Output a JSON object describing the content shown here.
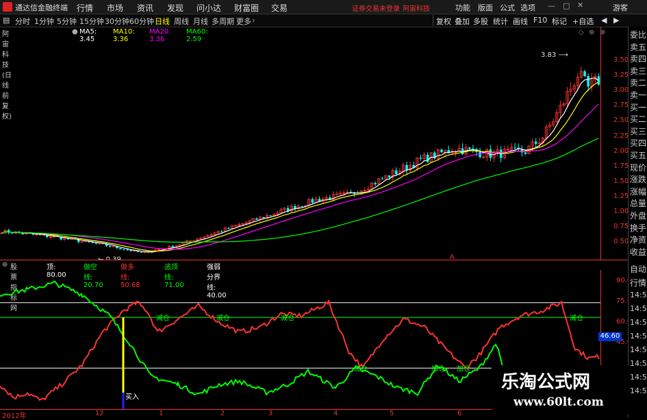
{
  "menubar": {
    "app_name": "通达信金融终端",
    "menus": [
      "行情",
      "市场",
      "资讯",
      "发现",
      "问小达",
      "财富圈",
      "交易"
    ],
    "warning": "证券交易未登录",
    "stock_name": "阿宙科技",
    "right_menus": [
      "功能",
      "版面",
      "公式",
      "选项"
    ],
    "guest": "游客"
  },
  "toolbar": {
    "timeframes": [
      "分时",
      "1分钟",
      "5分钟",
      "15分钟",
      "30分钟",
      "60分钟",
      "日线",
      "周线",
      "月线",
      "多周期",
      "更多"
    ],
    "active": "日线",
    "buttons": [
      "复权",
      "叠加",
      "多股",
      "统计",
      "画线",
      "F10",
      "标记",
      "+自选"
    ]
  },
  "main_chart": {
    "title": "阿宙科技(日线 前复权)",
    "ma": [
      {
        "label": "MA5: 3.45",
        "color": "#ffffff"
      },
      {
        "label": "MA10: 3.36",
        "color": "#ffff00"
      },
      {
        "label": "MA20: 3.36",
        "color": "#ff00ff"
      },
      {
        "label": "MA60: 2.59",
        "color": "#00ff00"
      }
    ],
    "high_label": "3.83",
    "low_label": "0.39",
    "y_ticks": [
      "3.50",
      "3.25",
      "3.00",
      "2.75",
      "2.50",
      "2.25",
      "2.00",
      "1.75",
      "1.50",
      "1.25",
      "1.00",
      "0.75",
      "0.50"
    ]
  },
  "indicator": {
    "title": "股票指标网",
    "items": [
      {
        "label": "顶: 80.00",
        "color": "#ffffff"
      },
      {
        "label": "做空线: 20.70",
        "color": "#00ff00"
      },
      {
        "label": "做多线: 50.68",
        "color": "#ff3333"
      },
      {
        "label": "逃顶线: 71.00",
        "color": "#00ff00"
      },
      {
        "label": "强弱分界线: 40.00",
        "color": "#ffffff"
      }
    ],
    "y_ticks": [
      "90.00",
      "75.00",
      "60.00",
      "45.00"
    ],
    "current_value": "46.60",
    "signal_reduce": "减仓",
    "signal_add": "加仓",
    "signal_buy": "买入"
  },
  "x_axis": [
    "2012年",
    "12",
    "1",
    "2",
    "3",
    "4",
    "5",
    "6"
  ],
  "sidebar_top": [
    "委比",
    "卖五",
    "卖四",
    "卖三",
    "卖二",
    "卖一",
    "买一",
    "买二",
    "买三",
    "买四",
    "买五",
    "现价",
    "涨跌",
    "涨幅",
    "总量",
    "外盘",
    "换手",
    "净资",
    "收益"
  ],
  "sidebar_bottom": [
    "自动",
    "行情",
    "14:50",
    "14:50",
    "14:50",
    "14:50",
    "14:50",
    "14:50",
    "14:50",
    "14:50"
  ],
  "watermark": {
    "cn": "乐淘公式网",
    "url": "www.60lt.com"
  },
  "colors": {
    "up": "#ff3333",
    "down": "#00ffff",
    "ma5": "#ffffff",
    "ma10": "#ffff00",
    "ma20": "#ff00ff",
    "ma60": "#00ff00",
    "long": "#ff3333",
    "short": "#00ff00"
  }
}
